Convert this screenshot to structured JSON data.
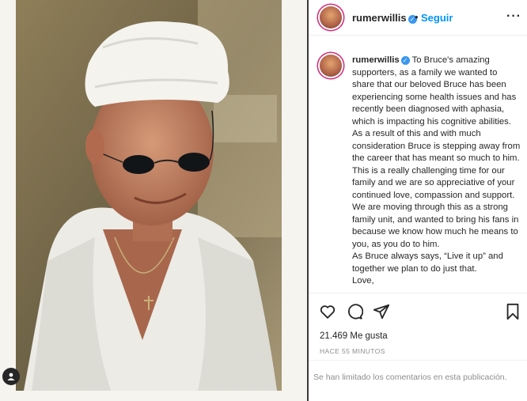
{
  "post": {
    "username": "rumerwillis",
    "follow_label": "Seguir",
    "separator": "•",
    "caption_lines": [
      "To Bruce's amazing supporters, as a family we wanted to share that our beloved Bruce has been experiencing some health issues and has recently been diagnosed with aphasia, which is impacting his cognitive abilities. As a result of this and with much consideration Bruce is stepping away from the career that has meant so much to him.",
      "This is a really challenging time for our family and we are so appreciative of your continued love, compassion and support. We are moving through this as a strong family unit, and wanted to bring his fans in because we know how much he means to you, as you do to him.",
      "As Bruce always says, “Live it up” and together we plan to do just that.",
      "Love,"
    ],
    "likes": "21.469 Me gusta",
    "timestamp": "HACE 55 MINUTOS",
    "comments_limited": "Se han limitado los comentarios en esta publicación."
  },
  "icons": {
    "verified": "verified-badge-icon",
    "more": "more-options-icon",
    "like": "heart-icon",
    "comment": "comment-icon",
    "share": "send-icon",
    "save": "bookmark-icon",
    "tag": "user-tag-icon"
  },
  "colors": {
    "accent": "#0095f6",
    "verified": "#3897f0",
    "muted": "#8e8e8e",
    "divider": "#3a3a3a"
  }
}
